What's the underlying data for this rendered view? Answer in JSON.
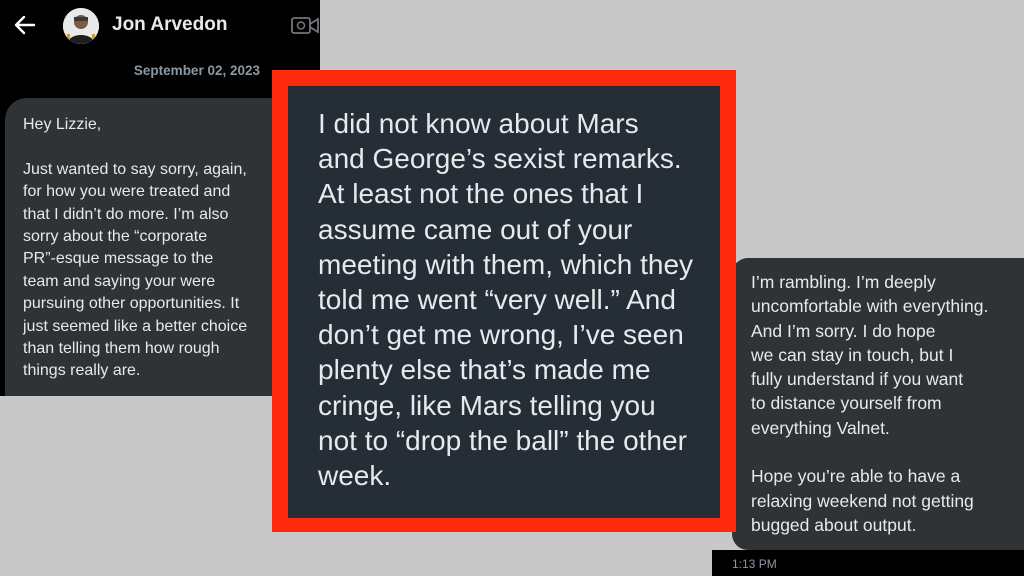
{
  "header": {
    "back_icon": "arrow-left-icon",
    "contact_name": "Jon Arvedon",
    "video_icon": "video-camera-icon"
  },
  "date_separator": "September 02, 2023",
  "messages": {
    "left": "Hey Lizzie,\n\nJust wanted to say sorry, again,\nfor how you were treated and\nthat I didn’t do more. I’m also\nsorry about the “corporate\nPR”-esque message to the\nteam and saying your were\npursuing other opportunities. It\njust seemed like a better choice\nthan telling them how rough\nthings really are.",
    "highlighted": "I did not know about Mars\nand George’s sexist remarks.\nAt least not the ones that I\nassume came out of your\nmeeting with them, which they\ntold me went “very well.” And\ndon’t get me wrong, I’ve seen\nplenty else that’s made me\ncringe, like Mars telling you\nnot to “drop the ball” the other\nweek.",
    "right": "I’m rambling. I’m deeply\nuncomfortable with everything.\nAnd I’m sorry. I do hope\nwe can stay in touch, but I\nfully understand if you want\nto distance yourself from\neverything Valnet.\n\nHope you’re able to have a\nrelaxing weekend not getting\nbugged about output.",
    "right_time": "1:13 PM"
  },
  "colors": {
    "highlight_border": "#ff2a0e",
    "bubble_bg": "#2f3336",
    "canvas_bg": "#c8c8c8"
  }
}
